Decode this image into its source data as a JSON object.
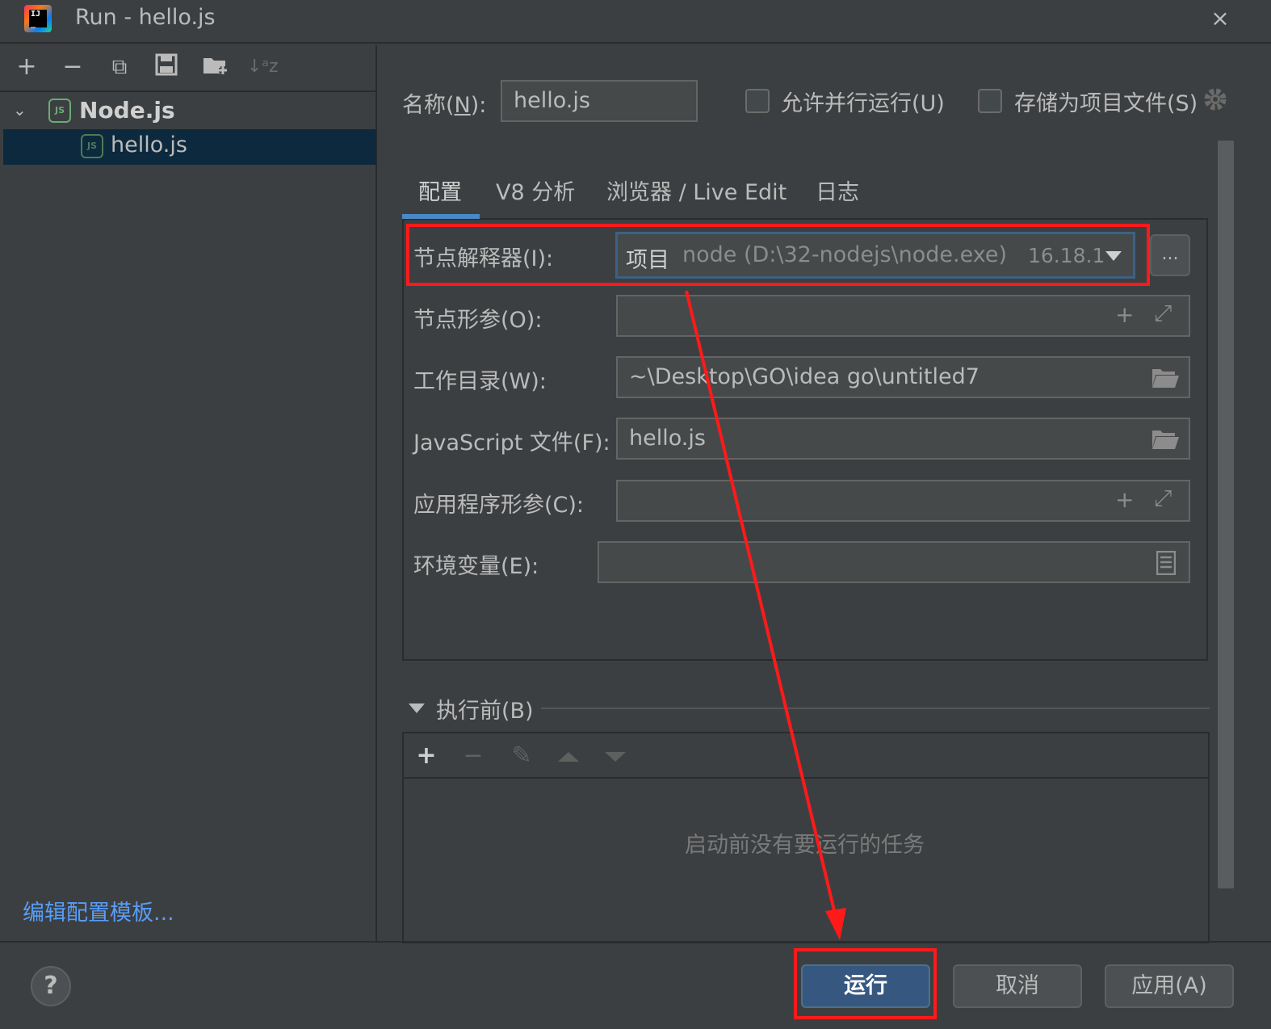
{
  "window": {
    "title": "Run - hello.js",
    "close_icon": "×"
  },
  "left_toolbar": {
    "add": "+",
    "remove": "−",
    "copy": "⧉",
    "save": "💾",
    "folder_add": "📁",
    "sort": "↓ᵃz"
  },
  "tree": {
    "group_label": "Node.js",
    "child_label": "hello.js",
    "icon_text": "JS"
  },
  "edit_templates_link": "编辑配置模板...",
  "form": {
    "name_label_pre": "名称(",
    "name_label_key": "N",
    "name_label_post": "):",
    "name_value": "hello.js",
    "allow_parallel": "允许并行运行(U)",
    "store_as_file": "存储为项目文件(S)"
  },
  "tabs": [
    {
      "label": "配置"
    },
    {
      "label": "V8 分析"
    },
    {
      "label": "浏览器 / Live Edit"
    },
    {
      "label": "日志"
    }
  ],
  "fields": {
    "interpreter_label": "节点解释器(I):",
    "interpreter_kind": "项目",
    "interpreter_path": "node (D:\\32-nodejs\\node.exe)",
    "interpreter_version": "16.18.1",
    "browse_button": "...",
    "node_params_label": "节点形参(O):",
    "node_params_value": "",
    "workdir_label": "工作目录(W):",
    "workdir_value": "~\\Desktop\\GO\\idea go\\untitled7",
    "jsfile_label": "JavaScript 文件(F):",
    "jsfile_value": "hello.js",
    "app_params_label": "应用程序形参(C):",
    "app_params_value": "",
    "env_label": "环境变量(E):",
    "env_value": ""
  },
  "before_run": {
    "header": "执行前(B)",
    "empty_text": "启动前没有要运行的任务"
  },
  "buttons": {
    "help": "?",
    "run": "运行",
    "cancel": "取消",
    "apply": "应用(A)"
  },
  "colors": {
    "background": "#3c3f41",
    "selection": "#0d293e",
    "accent": "#4a88c7",
    "link": "#589df6",
    "annotation_red": "#ff1a1a"
  }
}
